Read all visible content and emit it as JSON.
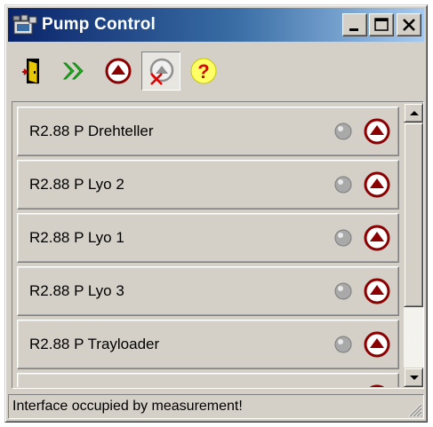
{
  "window": {
    "title": "Pump Control",
    "app_icon": "pump-control-app-icon",
    "controls": [
      "minimize-icon",
      "maximize-icon",
      "close-icon"
    ]
  },
  "toolbar": {
    "buttons": [
      {
        "name": "exit",
        "icon": "exit-door-icon",
        "pressed": false
      },
      {
        "name": "start-all",
        "icon": "double-arrow-right-icon",
        "pressed": false
      },
      {
        "name": "pump-up",
        "icon": "up-arrow-circle-icon",
        "pressed": false
      },
      {
        "name": "pump-disabled",
        "icon": "pump-disabled-icon",
        "pressed": true
      },
      {
        "name": "help",
        "icon": "question-icon",
        "pressed": false
      }
    ]
  },
  "pumps": [
    {
      "label": "R2.88 P Drehteller",
      "status_led": "gray-led-icon",
      "action_icon": "up-arrow-circle-icon"
    },
    {
      "label": "R2.88 P Lyo 2",
      "status_led": "gray-led-icon",
      "action_icon": "up-arrow-circle-icon"
    },
    {
      "label": "R2.88 P Lyo 1",
      "status_led": "gray-led-icon",
      "action_icon": "up-arrow-circle-icon"
    },
    {
      "label": "R2.88 P Lyo 3",
      "status_led": "gray-led-icon",
      "action_icon": "up-arrow-circle-icon"
    },
    {
      "label": "R2.88 P Trayloader",
      "status_led": "gray-led-icon",
      "action_icon": "up-arrow-circle-icon"
    },
    {
      "label": "",
      "status_led": "gray-led-icon",
      "action_icon": "up-arrow-circle-icon"
    }
  ],
  "statusbar": {
    "text": "Interface occupied by measurement!"
  },
  "colors": {
    "titlebar_start": "#0a246a",
    "titlebar_end": "#a6caf0",
    "face": "#d4d0c8",
    "pump_action": "#8b0000",
    "led": "#a9a9a9"
  }
}
